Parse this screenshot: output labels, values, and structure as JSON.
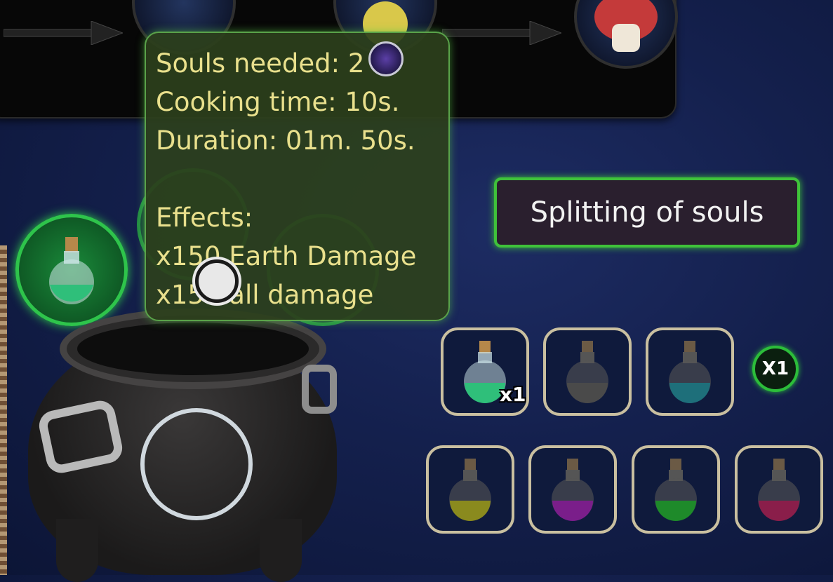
{
  "recipe": {
    "title": "Splitting of souls"
  },
  "tooltip": {
    "souls_needed": "Souls needed: 2",
    "cooking_time": "Cooking time: 10s.",
    "duration": "Duration: 01m. 50s.",
    "effects_label": "Effects:",
    "effects": [
      "x150 Earth Damage",
      "x150 all damage"
    ]
  },
  "slots": {
    "row1": [
      {
        "color": "#2fbf7a",
        "count": "x1",
        "icon": "green-potion-icon"
      },
      {
        "color": "#4a4a4a",
        "count": "",
        "icon": "empty-potion-icon"
      },
      {
        "color": "#1e6f7a",
        "count": "",
        "icon": "teal-potion-icon"
      }
    ],
    "row2": [
      {
        "color": "#8a8a1e",
        "icon": "yellow-potion-icon"
      },
      {
        "color": "#7a1e8a",
        "icon": "purple-potion-icon"
      },
      {
        "color": "#1e8a2a",
        "icon": "green-potion-icon"
      },
      {
        "color": "#8a1e4a",
        "icon": "red-potion-icon"
      }
    ]
  },
  "multiplier_button": "X1",
  "colors": {
    "accent_green": "#3fc23a",
    "tooltip_text": "#e9e08d"
  }
}
